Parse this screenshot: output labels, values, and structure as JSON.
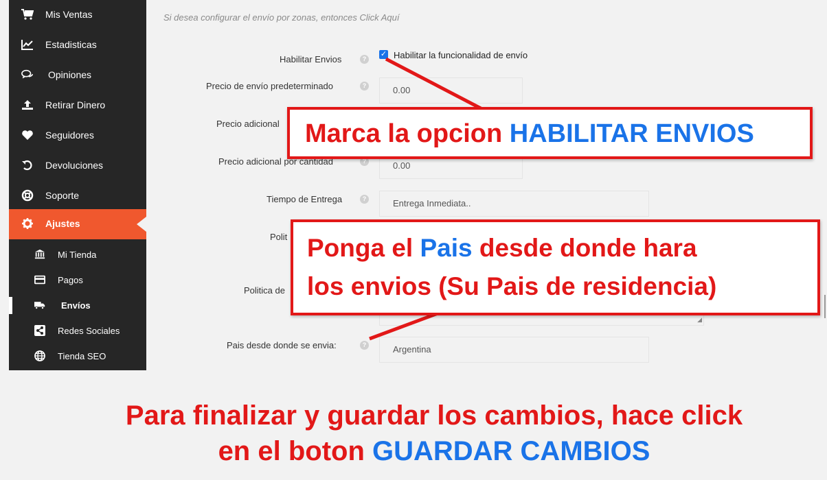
{
  "sidebar": {
    "items": [
      {
        "label": "Mis Ventas",
        "icon": "cart-icon"
      },
      {
        "label": "Estadisticas",
        "icon": "chart-icon"
      },
      {
        "label": "Opiniones",
        "icon": "chat-icon"
      },
      {
        "label": "Retirar Dinero",
        "icon": "upload-icon"
      },
      {
        "label": "Seguidores",
        "icon": "heart-icon"
      },
      {
        "label": "Devoluciones",
        "icon": "undo-icon"
      },
      {
        "label": "Soporte",
        "icon": "lifebuoy-icon"
      },
      {
        "label": "Ajustes",
        "icon": "gear-icon",
        "active": true
      }
    ],
    "subitems": [
      {
        "label": "Mi Tienda",
        "icon": "bank-icon"
      },
      {
        "label": "Pagos",
        "icon": "card-icon"
      },
      {
        "label": "Envíos",
        "icon": "truck-icon",
        "current": true
      },
      {
        "label": "Redes Sociales",
        "icon": "share-icon"
      },
      {
        "label": "Tienda SEO",
        "icon": "globe-icon"
      }
    ],
    "colors": {
      "background": "#262626",
      "active": "#f0582e"
    }
  },
  "main": {
    "hint": "Si desea configurar el envío por zonas, entonces Click Aquí",
    "fields": {
      "enable_label": "Habilitar Envios",
      "enable_checkbox_label": "Habilitar la funcionalidad de envío",
      "enable_checked": true,
      "default_price_label": "Precio de envío predeterminado",
      "default_price_value": "0.00",
      "additional_label_partial": "Precio adicional",
      "qty_price_label": "Precio adicional por cantidad",
      "qty_price_value": "0.00",
      "delivery_time_label": "Tiempo de Entrega",
      "delivery_time_value": "Entrega Inmediata..",
      "policy_label_partial": "Polit",
      "policy2_label_partial": "Politica de",
      "country_label": "Pais desde donde se envia:",
      "country_value": "Argentina"
    }
  },
  "annotations": {
    "callout1": {
      "red": "Marca la opcion ",
      "blue": "HABILITAR ENVIOS"
    },
    "callout2": {
      "red1": "Ponga el ",
      "blue": "Pais",
      "red2": " desde donde hara",
      "line2": "los envios (Su Pais de residencia)"
    },
    "bottom": {
      "line1": "Para finalizar y guardar los cambios, hace click",
      "line2_red": "en el boton ",
      "line2_blue": "GUARDAR CAMBIOS"
    },
    "colors": {
      "red": "#e21818",
      "blue": "#1a73e8"
    }
  }
}
